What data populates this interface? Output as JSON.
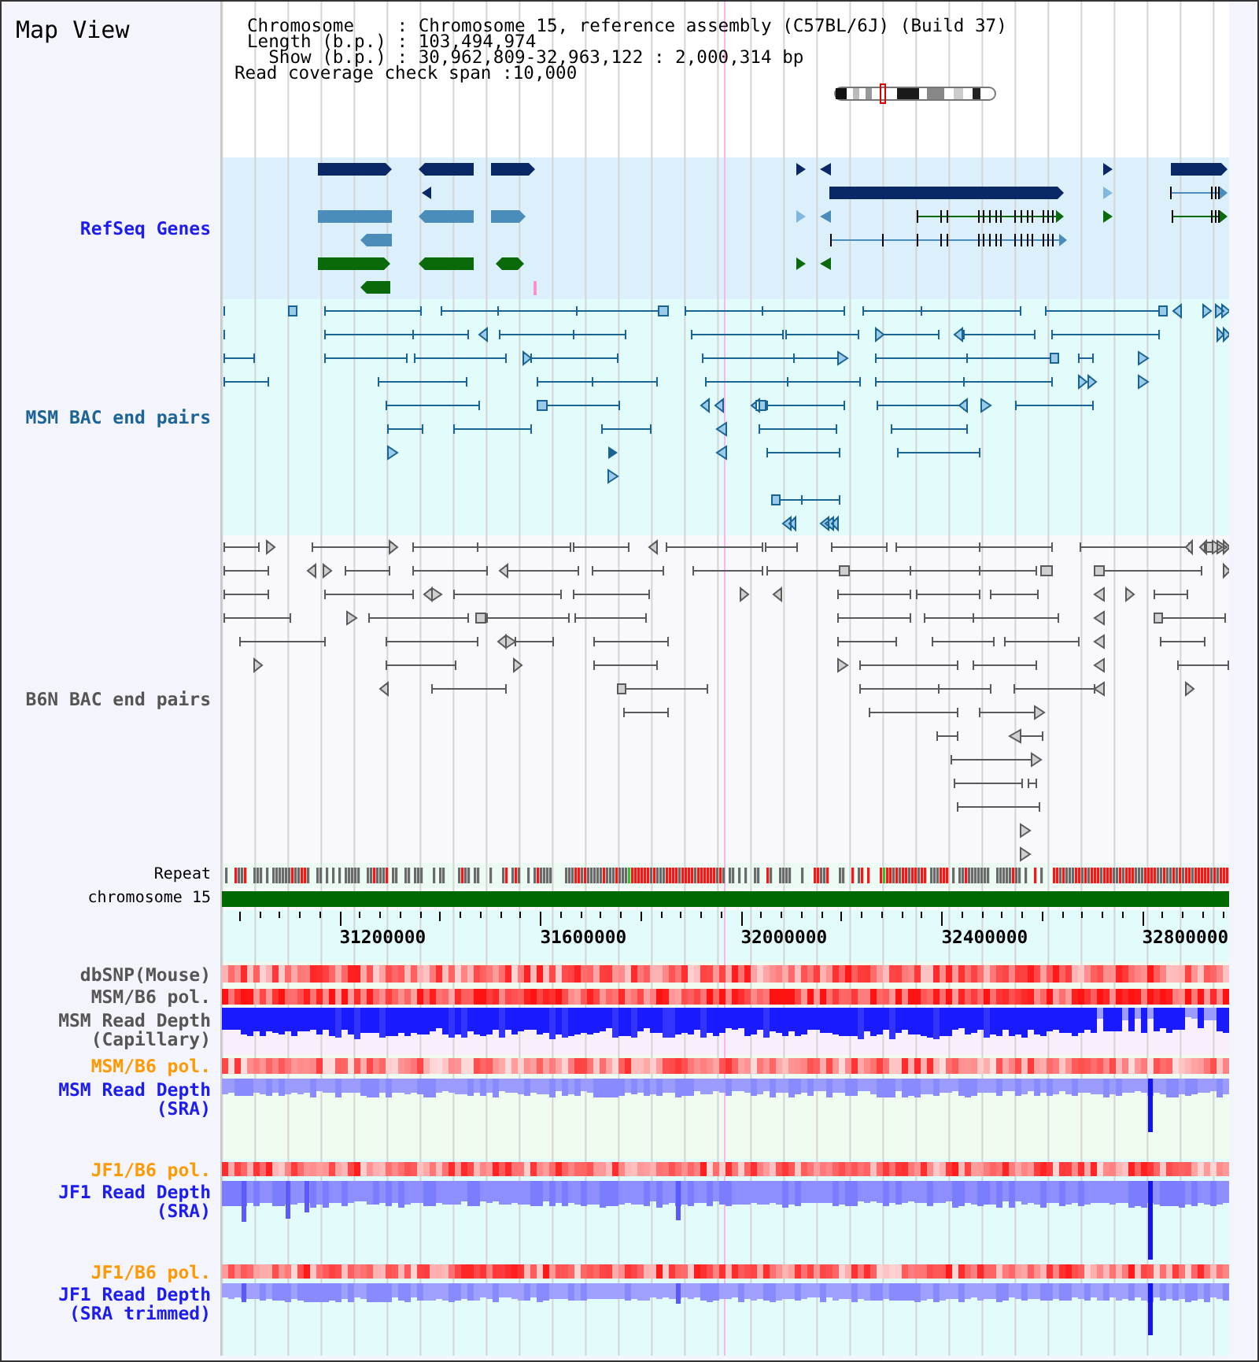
{
  "title": "Map View",
  "info": {
    "rows": [
      {
        "label": "Chromosome    :",
        "value": "Chromosome 15, reference assembly (C57BL/6J) (Build 37)"
      },
      {
        "label": "Length (b.p.) :",
        "value": "103,494,974"
      },
      {
        "label": "Show (b.p.) :",
        "value": "30,962,809-32,963,122 : 2,000,314 bp"
      }
    ],
    "span": {
      "label": "Read coverage check span :",
      "value": "10,000"
    }
  },
  "tracks": [
    {
      "kind": "genes",
      "label": "RefSeq Genes",
      "color": "#1c1cf0"
    },
    {
      "kind": "pairs",
      "label": "MSM BAC end pairs",
      "color": "#1c6496"
    },
    {
      "kind": "pairs",
      "label": "B6N BAC end pairs",
      "color": "#555555"
    },
    {
      "kind": "repeat",
      "label": "Repeat",
      "color": "#000000"
    },
    {
      "kind": "chromosome",
      "label": "chromosome 15",
      "color": "#000000"
    },
    {
      "kind": "ruler",
      "labels": [
        "31200000",
        "31600000",
        "32000000",
        "32400000",
        "32800000"
      ]
    },
    {
      "kind": "heat",
      "label": "dbSNP(Mouse)",
      "color": "#555555"
    },
    {
      "kind": "heat",
      "label": "MSM/B6 pol.",
      "color": "#555555"
    },
    {
      "kind": "depth",
      "label": "MSM Read Depth (Capillary)",
      "color": "#555555"
    },
    {
      "kind": "heat",
      "label": "MSM/B6 pol.",
      "color": "#ff9900"
    },
    {
      "kind": "depth",
      "label": "MSM Read Depth (SRA)",
      "color": "#1c1cf0"
    },
    {
      "kind": "heat",
      "label": "JF1/B6 pol.",
      "color": "#ff9900"
    },
    {
      "kind": "depth",
      "label": "JF1 Read Depth (SRA)",
      "color": "#1c1cf0"
    },
    {
      "kind": "heat",
      "label": "JF1/B6 pol.",
      "color": "#ff9900"
    },
    {
      "kind": "depth",
      "label": "JF1 Read Depth (SRA trimmed)",
      "color": "#1c1cf0"
    }
  ]
}
